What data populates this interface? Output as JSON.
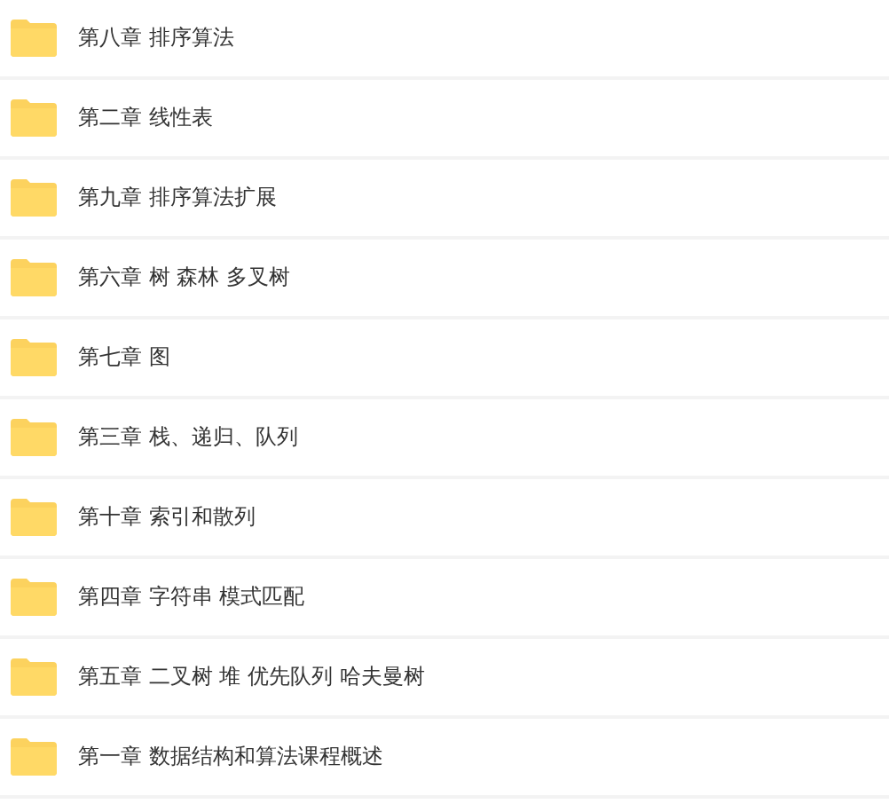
{
  "folders": [
    {
      "name": "第八章 排序算法"
    },
    {
      "name": "第二章 线性表"
    },
    {
      "name": "第九章 排序算法扩展"
    },
    {
      "name": "第六章 树 森林 多叉树"
    },
    {
      "name": "第七章 图"
    },
    {
      "name": "第三章 栈、递归、队列"
    },
    {
      "name": "第十章 索引和散列"
    },
    {
      "name": "第四章 字符串 模式匹配"
    },
    {
      "name": "第五章 二叉树 堆 优先队列 哈夫曼树"
    },
    {
      "name": "第一章 数据结构和算法课程概述"
    }
  ]
}
